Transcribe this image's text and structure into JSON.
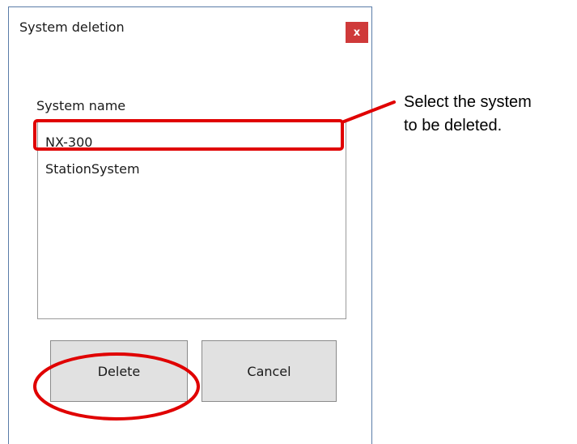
{
  "dialog": {
    "title": "System deletion",
    "close_label": "x",
    "system_name_label": "System name",
    "systems": [
      "NX-300",
      "StationSystem"
    ],
    "delete_label": "Delete",
    "cancel_label": "Cancel"
  },
  "annotation": {
    "line1": "Select the system",
    "line2": "to be deleted."
  },
  "colors": {
    "highlight": "#e00000",
    "close_button": "#cf3a3a"
  }
}
